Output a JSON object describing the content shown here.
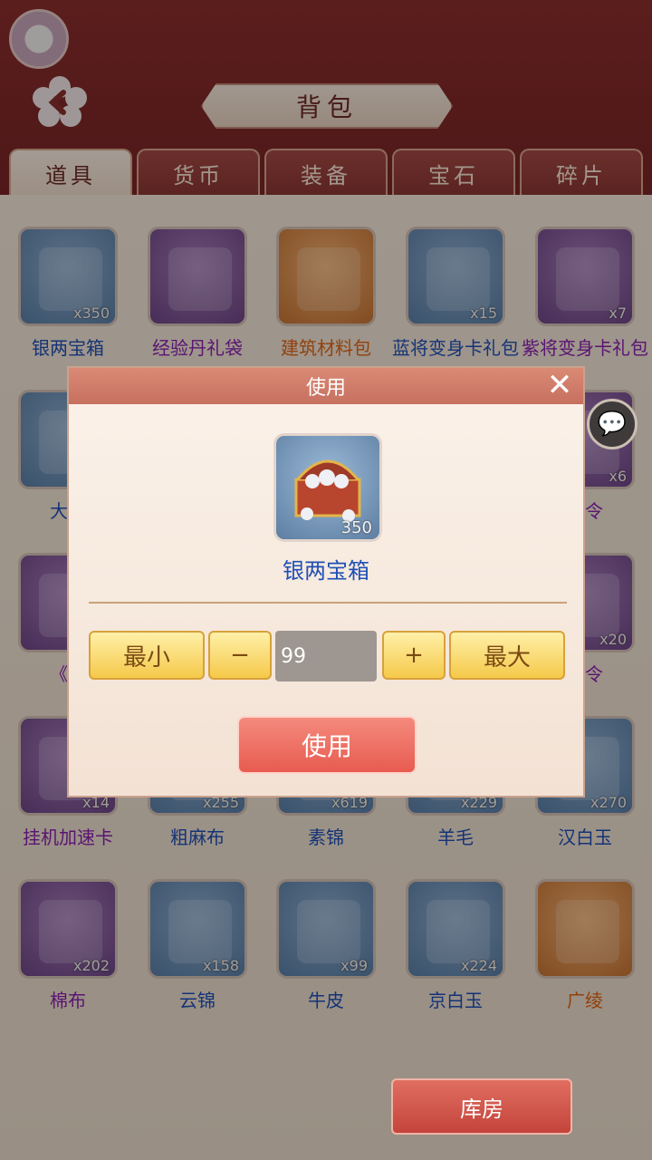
{
  "header": {
    "title": "背包",
    "back_icon": "back-flower-icon",
    "avatar_icon": "avatar-icon"
  },
  "tabs": [
    {
      "label": "道具",
      "active": true
    },
    {
      "label": "货币",
      "active": false
    },
    {
      "label": "装备",
      "active": false
    },
    {
      "label": "宝石",
      "active": false
    },
    {
      "label": "碎片",
      "active": false
    }
  ],
  "items": [
    {
      "name": "银两宝箱",
      "count": "x350",
      "color": "blue"
    },
    {
      "name": "经验丹礼袋",
      "count": "",
      "color": "purple"
    },
    {
      "name": "建筑材料包",
      "count": "",
      "color": "orange"
    },
    {
      "name": "蓝将变身卡礼包",
      "count": "x15",
      "color": "blue"
    },
    {
      "name": "紫将变身卡礼包",
      "count": "x7",
      "color": "purple"
    },
    {
      "name": "大经",
      "count": "",
      "color": "blue"
    },
    {
      "name": "",
      "count": "",
      "color": ""
    },
    {
      "name": "",
      "count": "",
      "color": ""
    },
    {
      "name": "",
      "count": "",
      "color": ""
    },
    {
      "name": "新令",
      "count": "x6",
      "color": "purple"
    },
    {
      "name": "《论",
      "count": "",
      "color": "purple"
    },
    {
      "name": "",
      "count": "",
      "color": ""
    },
    {
      "name": "",
      "count": "",
      "color": ""
    },
    {
      "name": "",
      "count": "",
      "color": ""
    },
    {
      "name": "番令",
      "count": "x20",
      "color": "purple"
    },
    {
      "name": "挂机加速卡",
      "count": "x14",
      "color": "purple"
    },
    {
      "name": "粗麻布",
      "count": "x255",
      "color": "blue"
    },
    {
      "name": "素锦",
      "count": "x619",
      "color": "blue"
    },
    {
      "name": "羊毛",
      "count": "x229",
      "color": "blue"
    },
    {
      "name": "汉白玉",
      "count": "x270",
      "color": "blue"
    },
    {
      "name": "棉布",
      "count": "x202",
      "color": "purple"
    },
    {
      "name": "云锦",
      "count": "x158",
      "color": "blue"
    },
    {
      "name": "牛皮",
      "count": "x99",
      "color": "blue"
    },
    {
      "name": "京白玉",
      "count": "x224",
      "color": "blue"
    },
    {
      "name": "广绫",
      "count": "",
      "color": "orange"
    }
  ],
  "dialog": {
    "title": "使用",
    "close_icon": "close-icon",
    "item_name": "银两宝箱",
    "item_count": "350",
    "min_label": "最小",
    "minus_label": "−",
    "quantity": "99",
    "plus_label": "+",
    "max_label": "最大",
    "use_label": "使用"
  },
  "chat_icon": "chat-icon",
  "chat_glyph": "💬",
  "warehouse_label": "库房"
}
